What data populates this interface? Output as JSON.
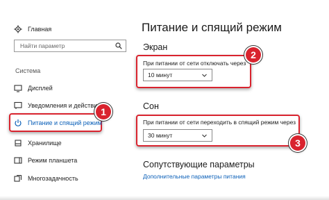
{
  "sidebar": {
    "home": {
      "label": "Главная",
      "icon": "gear-icon"
    },
    "search": {
      "placeholder": "Найти параметр",
      "icon": "search-icon"
    },
    "section_title": "Система",
    "items": [
      {
        "label": "Дисплей",
        "icon": "display-icon"
      },
      {
        "label": "Уведомления и действия",
        "icon": "notifications-icon"
      },
      {
        "label": "Питание и спящий режим",
        "icon": "power-icon",
        "active": true
      },
      {
        "label": "Хранилище",
        "icon": "storage-icon"
      },
      {
        "label": "Режим планшета",
        "icon": "tablet-icon"
      },
      {
        "label": "Многозадачность",
        "icon": "multitask-icon"
      }
    ]
  },
  "main": {
    "title": "Питание и спящий режим",
    "screen": {
      "heading": "Экран",
      "label": "При питании от сети отключать через",
      "value": "10 минут"
    },
    "sleep": {
      "heading": "Сон",
      "label": "При питании от сети переходить в спящий режим через",
      "value": "30 минут"
    },
    "related": {
      "heading": "Сопутствующие параметры",
      "link": "Дополнительные параметры питания"
    }
  },
  "annotations": {
    "badge1": "1",
    "badge2": "2",
    "badge3": "3",
    "color": "#d9232e"
  },
  "colors": {
    "accent": "#0a5fb8",
    "highlight": "#d9232e"
  }
}
